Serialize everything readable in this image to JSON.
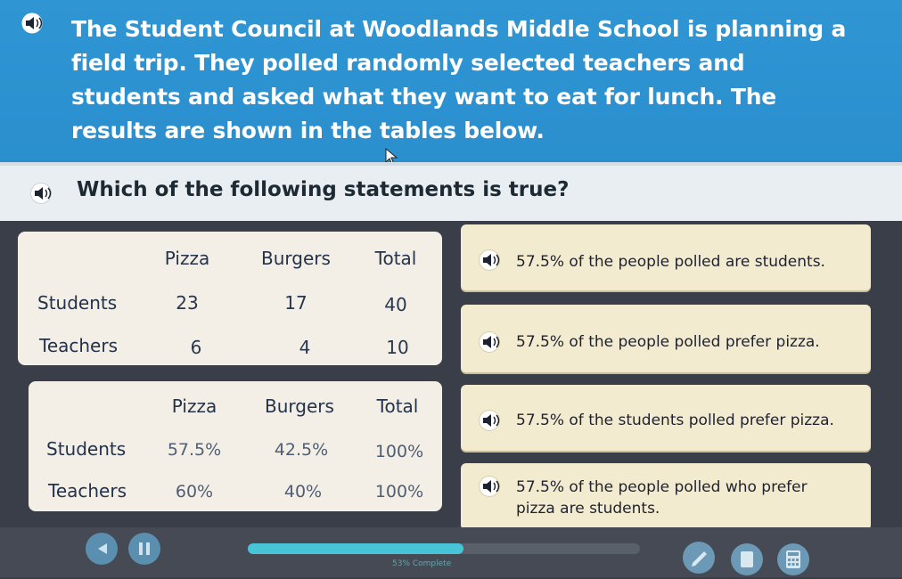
{
  "question": {
    "text": "The Student Council at Woodlands Middle School is planning a field trip. They polled randomly selected teachers and students and asked what they want to eat for lunch. The results are shown in the tables below.",
    "prompt": "Which of the following statements is true?"
  },
  "count_table": {
    "headers": [
      "Pizza",
      "Burgers",
      "Total"
    ],
    "rows": [
      {
        "label": "Students",
        "values": [
          "23",
          "17",
          "40"
        ]
      },
      {
        "label": "Teachers",
        "values": [
          "6",
          "4",
          "10"
        ]
      }
    ]
  },
  "percent_table": {
    "headers": [
      "Pizza",
      "Burgers",
      "Total"
    ],
    "rows": [
      {
        "label": "Students",
        "values": [
          "57.5%",
          "42.5%",
          "100%"
        ]
      },
      {
        "label": "Teachers",
        "values": [
          "60%",
          "40%",
          "100%"
        ]
      }
    ]
  },
  "answers": [
    {
      "text": "57.5% of the people polled are students."
    },
    {
      "text": "57.5% of the people polled prefer pizza."
    },
    {
      "text": "57.5% of the students polled prefer pizza."
    },
    {
      "text_line1": "57.5% of the people polled who prefer",
      "text_line2": "pizza are students."
    }
  ],
  "progress": {
    "percent": 55,
    "label": "53% Complete"
  },
  "colors": {
    "banner": "#2f95d3",
    "answer_bg": "#f3ebcf",
    "progress": "#47c5d6"
  }
}
